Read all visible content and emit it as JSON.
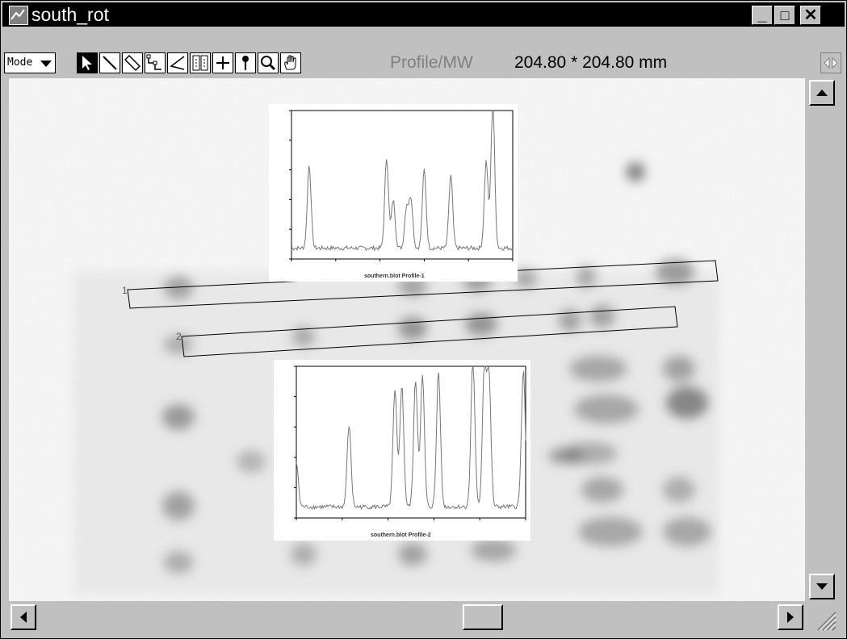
{
  "window": {
    "title": "south_rot",
    "minimize_label": "_",
    "maximize_label": "□",
    "close_label": "✕"
  },
  "toolbar": {
    "mode_label": "Mode",
    "tools": [
      {
        "icon": "arrow-pointer-icon",
        "selected": true
      },
      {
        "icon": "line-tool-icon"
      },
      {
        "icon": "rectangle-tool-icon"
      },
      {
        "icon": "segmented-line-icon"
      },
      {
        "icon": "angle-tool-icon"
      },
      {
        "icon": "lane-tool-icon"
      },
      {
        "icon": "crosshair-icon"
      },
      {
        "icon": "pin-icon"
      },
      {
        "icon": "magnifier-icon"
      },
      {
        "icon": "hand-icon"
      }
    ],
    "status_label": "Profile/MW",
    "status_value": "204.80 * 204.80 mm"
  },
  "annotations": {
    "lane1_label": "1",
    "lane2_label": "2"
  },
  "plots": [
    {
      "caption": "southern.blot Profile-1",
      "peaks": [
        [
          0.08,
          0.57
        ],
        [
          0.43,
          0.62
        ],
        [
          0.46,
          0.33
        ],
        [
          0.52,
          0.28
        ],
        [
          0.54,
          0.34
        ],
        [
          0.6,
          0.54
        ],
        [
          0.72,
          0.5
        ],
        [
          0.88,
          0.6
        ],
        [
          0.91,
          1.0
        ]
      ]
    },
    {
      "caption": "southern.blot Profile-2",
      "peaks": [
        [
          0.0,
          0.3
        ],
        [
          0.23,
          0.55
        ],
        [
          0.43,
          0.78
        ],
        [
          0.46,
          0.82
        ],
        [
          0.52,
          0.85
        ],
        [
          0.55,
          0.88
        ],
        [
          0.62,
          0.92
        ],
        [
          0.77,
          1.0
        ],
        [
          0.82,
          0.95
        ],
        [
          0.84,
          0.88
        ],
        [
          0.99,
          0.92
        ]
      ]
    }
  ],
  "colors": {
    "title_bar": "#000000",
    "chrome": "#c0c0c0",
    "canvas": "#ffffff",
    "plot_line": "#777777"
  }
}
